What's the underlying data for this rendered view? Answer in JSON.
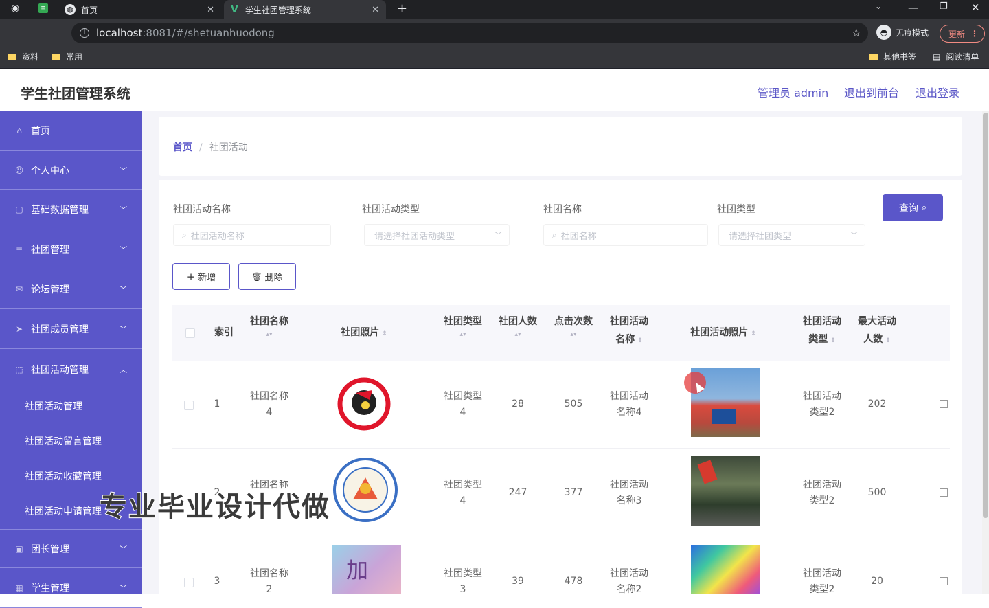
{
  "browser": {
    "tabs": [
      {
        "label": "首页",
        "icon": "globe-icon"
      },
      {
        "label": "学生社团管理系统",
        "icon": "vue-icon"
      }
    ],
    "url_host": "localhost",
    "url_path": ":8081/#/shetuanhuodong",
    "incognito_label": "无痕模式",
    "update_label": "更新",
    "bookmarks": [
      "资料",
      "常用"
    ],
    "bookmarks_right": [
      "其他书签",
      "阅读清单"
    ]
  },
  "app": {
    "title": "学生社团管理系统",
    "user_label": "管理员 admin",
    "to_front": "退出到前台",
    "logout": "退出登录"
  },
  "sidebar": {
    "items": [
      {
        "label": "首页",
        "icon": "home-icon"
      },
      {
        "label": "个人中心",
        "icon": "user-icon"
      },
      {
        "label": "基础数据管理",
        "icon": "data-icon"
      },
      {
        "label": "社团管理",
        "icon": "list-icon"
      },
      {
        "label": "论坛管理",
        "icon": "mail-icon"
      },
      {
        "label": "社团成员管理",
        "icon": "send-icon"
      },
      {
        "label": "社团活动管理",
        "icon": "frame-icon"
      }
    ],
    "sub_items": [
      "社团活动管理",
      "社团活动留言管理",
      "社团活动收藏管理",
      "社团活动申请管理"
    ],
    "items_after": [
      {
        "label": "团长管理",
        "icon": "card-icon"
      },
      {
        "label": "学生管理",
        "icon": "grid-icon"
      }
    ]
  },
  "breadcrumb": {
    "home": "首页",
    "current": "社团活动"
  },
  "filters": {
    "activity_name_label": "社团活动名称",
    "activity_name_placeholder": "社团活动名称",
    "activity_type_label": "社团活动类型",
    "activity_type_placeholder": "请选择社团活动类型",
    "club_name_label": "社团名称",
    "club_name_placeholder": "社团名称",
    "club_type_label": "社团类型",
    "club_type_placeholder": "请选择社团类型",
    "query_label": "查询"
  },
  "actions": {
    "add_label": "新增",
    "delete_label": "删除"
  },
  "table": {
    "headers": {
      "index": "索引",
      "club_name": "社团名称",
      "club_photo": "社团照片",
      "club_type": "社团类型",
      "club_members": "社团人数",
      "clicks": "点击次数",
      "activity_name_1": "社团活动",
      "activity_name_2": "名称",
      "activity_photo": "社团活动照片",
      "activity_type_1": "社团活动",
      "activity_type_2": "类型",
      "max_people_1": "最大活动",
      "max_people_2": "人数"
    },
    "rows": [
      {
        "index": "1",
        "club_name_1": "社团名称",
        "club_name_2": "4",
        "club_type_1": "社团类型",
        "club_type_2": "4",
        "members": "28",
        "clicks": "505",
        "act_name_1": "社团活动",
        "act_name_2": "名称4",
        "act_type_1": "社团活动",
        "act_type_2": "类型2",
        "max_people": "202"
      },
      {
        "index": "2",
        "club_name_1": "社团名称",
        "club_name_2": "",
        "club_type_1": "社团类型",
        "club_type_2": "4",
        "members": "247",
        "clicks": "377",
        "act_name_1": "社团活动",
        "act_name_2": "名称3",
        "act_type_1": "社团活动",
        "act_type_2": "类型2",
        "max_people": "500"
      },
      {
        "index": "3",
        "club_name_1": "社团名称",
        "club_name_2": "2",
        "club_type_1": "社团类型",
        "club_type_2": "3",
        "members": "39",
        "clicks": "478",
        "act_name_1": "社团活动",
        "act_name_2": "名称2",
        "act_type_1": "社团活动",
        "act_type_2": "类型2",
        "max_people": "20"
      }
    ]
  },
  "overlay": {
    "watermark": "专业毕业设计代做"
  }
}
